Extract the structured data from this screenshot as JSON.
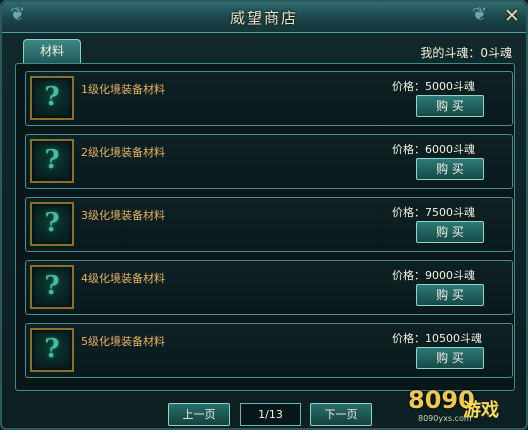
{
  "window": {
    "title": "威望商店",
    "close_icon": "close-icon"
  },
  "tabs": [
    {
      "label": "材料"
    }
  ],
  "soul_balance": "我的斗魂：0斗魂",
  "items": [
    {
      "name": "1级化境装备材料",
      "price": "价格：5000斗魂",
      "buy_label": "购 买"
    },
    {
      "name": "2级化境装备材料",
      "price": "价格：6000斗魂",
      "buy_label": "购 买"
    },
    {
      "name": "3级化境装备材料",
      "price": "价格：7500斗魂",
      "buy_label": "购 买"
    },
    {
      "name": "4级化境装备材料",
      "price": "价格：9000斗魂",
      "buy_label": "购 买"
    },
    {
      "name": "5级化境装备材料",
      "price": "价格：10500斗魂",
      "buy_label": "购 买"
    }
  ],
  "pager": {
    "prev_label": "上一页",
    "page": "1/13",
    "next_label": "下一页"
  },
  "watermark": {
    "brand": "8090",
    "site": "游戏",
    "url": "8090yxs.com"
  },
  "colors": {
    "accent": "#3e8784",
    "item_name": "#e7b15f",
    "text": "#f3f1df"
  }
}
